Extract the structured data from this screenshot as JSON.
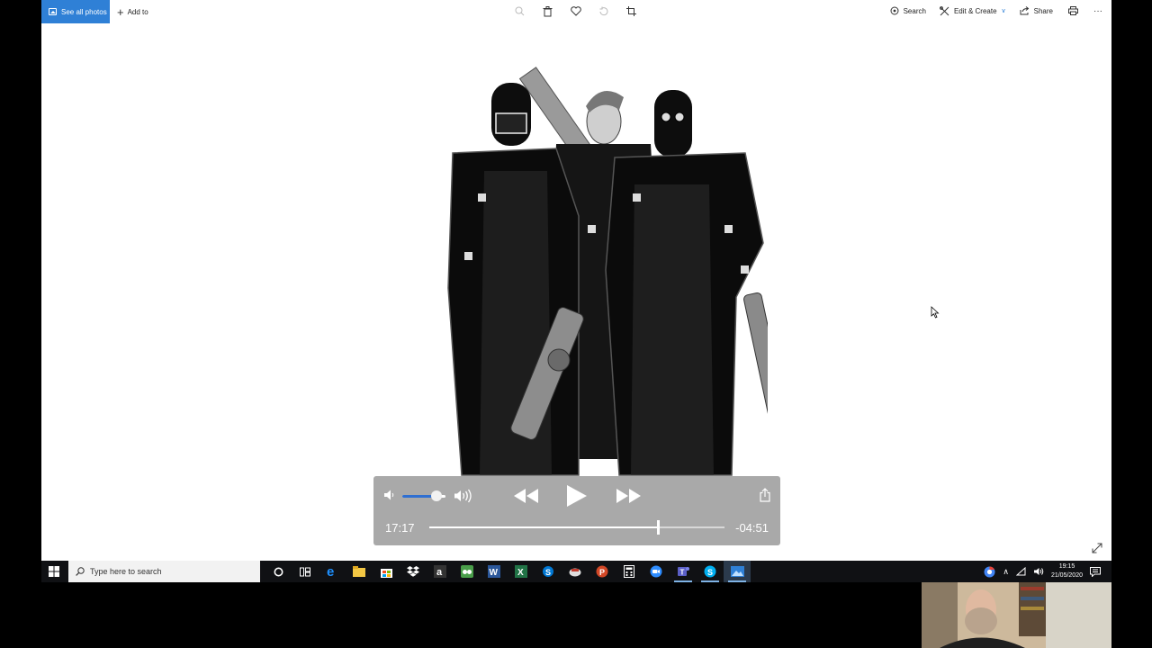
{
  "toolbar": {
    "see_all_photos": "See all photos",
    "add_to": "Add to",
    "search": "Search",
    "edit_create": "Edit & Create",
    "share": "Share",
    "more": "···"
  },
  "player": {
    "current_time": "17:17",
    "remaining_time": "-04:51",
    "volume_level": 0.8,
    "progress": 0.775
  },
  "taskbar": {
    "search_placeholder": "Type here to search",
    "time": "19:15",
    "date": "21/05/2020"
  },
  "colors": {
    "accent": "#2f80d6",
    "taskbar": "#101114",
    "volume_fill": "#2f6fd1"
  }
}
